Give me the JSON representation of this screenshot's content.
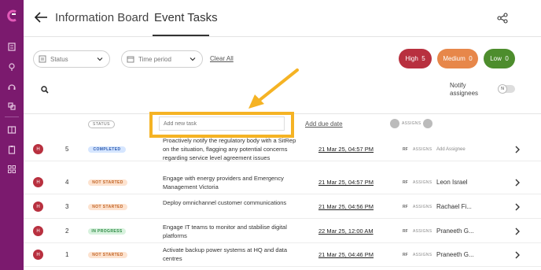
{
  "header": {
    "breadcrumb_1": "Information Board",
    "breadcrumb_2": "Event Tasks"
  },
  "filters": {
    "status_label": "Status",
    "time_label": "Time period",
    "clear_all": "Clear All"
  },
  "priority_pills": [
    {
      "label": "High",
      "count": "5",
      "color": "#b8303f"
    },
    {
      "label": "Medium",
      "count": "0",
      "color": "#e7874a"
    },
    {
      "label": "Low",
      "count": "0",
      "color": "#4d8d2d"
    }
  ],
  "notify": {
    "label": "Notify assignees",
    "toggle_state": "N"
  },
  "columns": {
    "status": "STATUS",
    "add_task_placeholder": "Add new task",
    "add_due_date": "Add due date",
    "assigns": "ASSIGNS"
  },
  "tasks": [
    {
      "priority": "H",
      "number": "5",
      "status": "COMPLETED",
      "text": "Proactively notify the regulatory body with a SitRep on the situation, flagging any potential concerns regarding service level agreement issues",
      "due": "21 Mar 25, 04:57 PM",
      "rf": "RF",
      "assigns": "ASSIGNS",
      "assignee": "Add Assignee"
    },
    {
      "priority": "H",
      "number": "4",
      "status": "NOT STARTED",
      "text": "Engage with energy providers and Emergency Management Victoria",
      "due": "21 Mar 25, 04:57 PM",
      "rf": "RF",
      "assigns": "ASSIGNS",
      "assignee": "Leon Israel"
    },
    {
      "priority": "H",
      "number": "3",
      "status": "NOT STARTED",
      "text": "Deploy omnichannel customer communications",
      "due": "21 Mar 25, 04:56 PM",
      "rf": "RF",
      "assigns": "ASSIGNS",
      "assignee": "Rachael Fi..."
    },
    {
      "priority": "H",
      "number": "2",
      "status": "IN PROGRESS",
      "text": "Engage IT teams to monitor and stabilise digital platforms",
      "due": "22 Mar 25, 12:00 AM",
      "rf": "RF",
      "assigns": "ASSIGNS",
      "assignee": "Praneeth G..."
    },
    {
      "priority": "H",
      "number": "1",
      "status": "NOT STARTED",
      "text": "Activate backup power systems at HQ and data centres",
      "due": "21 Mar 25, 04:46 PM",
      "rf": "RF",
      "assigns": "ASSIGNS",
      "assignee": "Praneeth G..."
    }
  ],
  "colors": {
    "sidebar": "#7b1a6e",
    "highlight": "#f5b324",
    "high": "#b8303f",
    "medium": "#e7874a",
    "low": "#4d8d2d"
  }
}
